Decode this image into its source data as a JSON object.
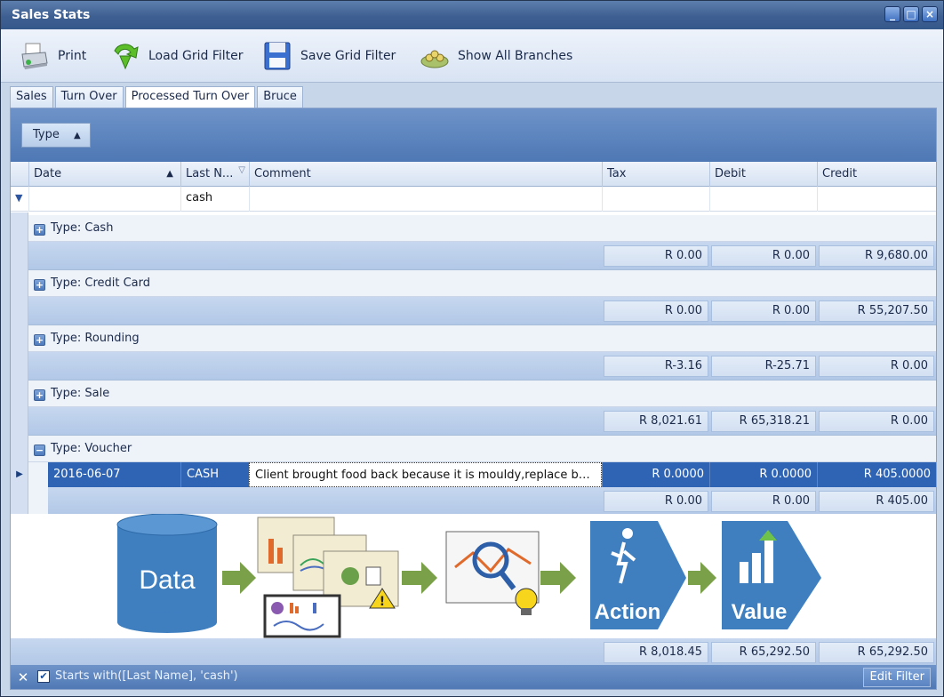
{
  "window": {
    "title": "Sales Stats"
  },
  "toolbar": {
    "print": "Print",
    "load_filter": "Load Grid Filter",
    "save_filter": "Save Grid Filter",
    "show_branches": "Show All Branches"
  },
  "tabs": [
    "Sales",
    "Turn Over",
    "Processed Turn Over",
    "Bruce"
  ],
  "active_tab": "Processed Turn Over",
  "group_by": "Type",
  "columns": [
    "Date",
    "Last N...",
    "Comment",
    "Tax",
    "Debit",
    "Credit"
  ],
  "filter_row": {
    "last_name": "cash"
  },
  "groups": [
    {
      "label": "Type: Cash",
      "tax": "R 0.00",
      "debit": "R 0.00",
      "credit": "R 9,680.00"
    },
    {
      "label": "Type: Credit Card",
      "tax": "R 0.00",
      "debit": "R 0.00",
      "credit": "R 55,207.50"
    },
    {
      "label": "Type: Rounding",
      "tax": "R-3.16",
      "debit": "R-25.71",
      "credit": "R 0.00"
    },
    {
      "label": "Type: Sale",
      "tax": "R 8,021.61",
      "debit": "R 65,318.21",
      "credit": "R 0.00"
    }
  ],
  "voucher_group": {
    "label": "Type: Voucher",
    "row": {
      "date": "2016-06-07",
      "last_name": "CASH",
      "comment": "Client brought food back because it is mouldy,replace bag a...",
      "tax": "R 0.0000",
      "debit": "R 0.0000",
      "credit": "R 405.0000"
    },
    "tax": "R 0.00",
    "debit": "R 0.00",
    "credit": "R 405.00"
  },
  "illustration": {
    "data_label": "Data",
    "action_label": "Action",
    "value_label": "Value"
  },
  "totals": {
    "tax": "R 8,018.45",
    "debit": "R 65,292.50",
    "credit": "R 65,292.50"
  },
  "filter_bar": {
    "text": "Starts with([Last Name], 'cash')",
    "edit_label": "Edit Filter"
  }
}
